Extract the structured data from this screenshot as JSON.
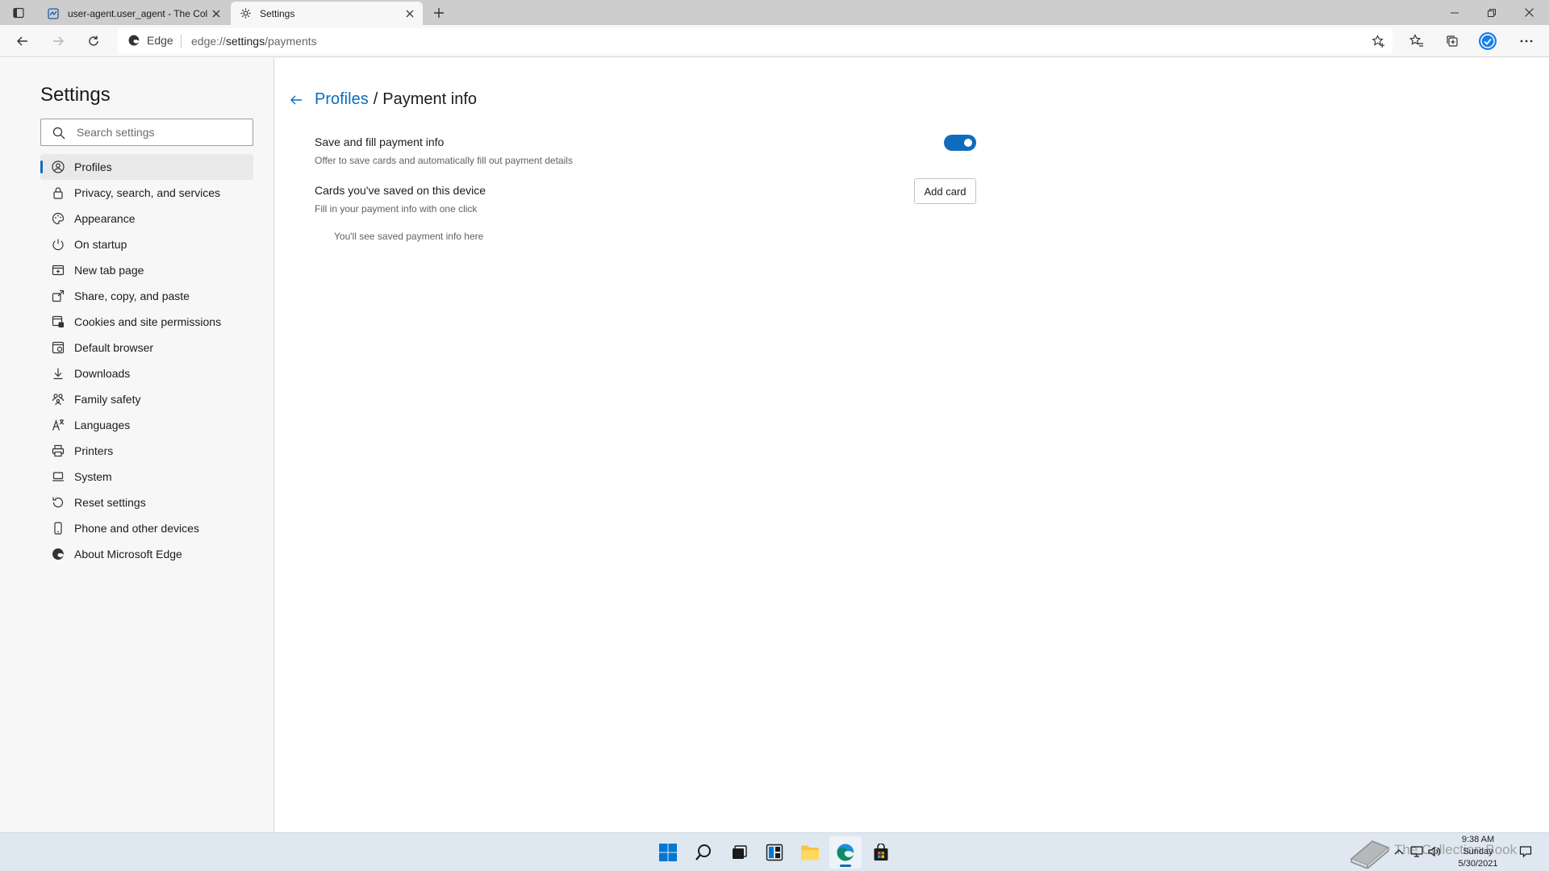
{
  "tabs": [
    {
      "title": "user-agent.user_agent - The Coll",
      "icon": "page-icon"
    },
    {
      "title": "Settings",
      "icon": "gear-icon"
    }
  ],
  "address": {
    "scheme_label": "Edge",
    "url_prefix": "edge://",
    "url_host": "settings",
    "url_path": "/payments"
  },
  "sidebar": {
    "title": "Settings",
    "search_placeholder": "Search settings",
    "items": [
      {
        "label": "Profiles",
        "icon": "profile-icon",
        "selected": true
      },
      {
        "label": "Privacy, search, and services",
        "icon": "lock-icon"
      },
      {
        "label": "Appearance",
        "icon": "appearance-icon"
      },
      {
        "label": "On startup",
        "icon": "power-icon"
      },
      {
        "label": "New tab page",
        "icon": "new-tab-icon"
      },
      {
        "label": "Share, copy, and paste",
        "icon": "share-icon"
      },
      {
        "label": "Cookies and site permissions",
        "icon": "cookies-icon"
      },
      {
        "label": "Default browser",
        "icon": "browser-icon"
      },
      {
        "label": "Downloads",
        "icon": "download-icon"
      },
      {
        "label": "Family safety",
        "icon": "family-icon"
      },
      {
        "label": "Languages",
        "icon": "language-icon"
      },
      {
        "label": "Printers",
        "icon": "printer-icon"
      },
      {
        "label": "System",
        "icon": "laptop-icon"
      },
      {
        "label": "Reset settings",
        "icon": "reset-icon"
      },
      {
        "label": "Phone and other devices",
        "icon": "phone-icon"
      },
      {
        "label": "About Microsoft Edge",
        "icon": "edge-icon"
      }
    ]
  },
  "main": {
    "breadcrumb_parent": "Profiles",
    "breadcrumb_sep": "/",
    "breadcrumb_current": "Payment info",
    "save_fill": {
      "title": "Save and fill payment info",
      "subtitle": "Offer to save cards and automatically fill out payment details",
      "enabled": true
    },
    "cards": {
      "title": "Cards you've saved on this device",
      "subtitle": "Fill in your payment info with one click",
      "button": "Add card",
      "empty_text": "You'll see saved payment info here"
    }
  },
  "taskbar": {
    "watermark": "The Collection Book",
    "time": "9:38 AM",
    "day": "Sunday",
    "date": "5/30/2021"
  },
  "colors": {
    "accent": "#0f6cbd",
    "sidebar_bg": "#f7f7f7",
    "taskbar_bg": "#dfe8f1"
  }
}
